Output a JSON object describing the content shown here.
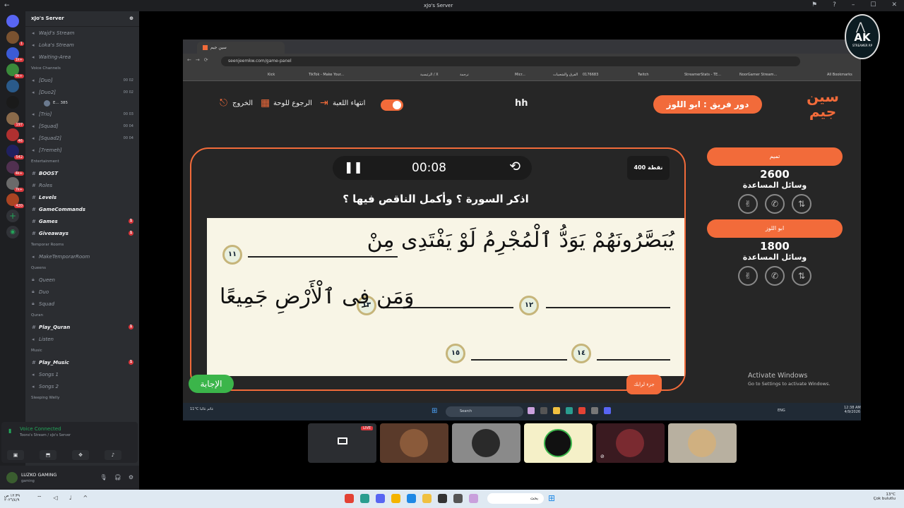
{
  "discord": {
    "window_title": "xJo's Server",
    "server_name": "xJo's Server",
    "rail_badges": [
      "1",
      "1k+",
      "9k+",
      "197",
      "46",
      "542",
      "4k+",
      "7k+",
      "420"
    ],
    "channels_top": [
      {
        "label": "Wajd's Stream",
        "type": "voice"
      },
      {
        "label": "Loka's Stream",
        "type": "voice"
      },
      {
        "label": "Waiting-Area",
        "type": "voice"
      }
    ],
    "voice_category": "Voice Channels",
    "voice_channels": [
      {
        "label": "[Duo]",
        "count": "00 02"
      },
      {
        "label": "[Duo2]",
        "count": "00 02"
      },
      {
        "label": "[Trio]",
        "count": "00 03"
      },
      {
        "label": "[Squad]",
        "count": "00 04"
      },
      {
        "label": "[Squad2]",
        "count": "00 04"
      },
      {
        "label": "[7remeh]",
        "count": ""
      }
    ],
    "sub_user": "E...",
    "sub_user_extra": "385",
    "entertainment_category": "Entertainment",
    "entertainment": [
      {
        "label": "BOOST",
        "unread": ""
      },
      {
        "label": "Roles",
        "unread": ""
      },
      {
        "label": "Levels",
        "unread": ""
      },
      {
        "label": "GameCommands",
        "unread": ""
      },
      {
        "label": "Games",
        "unread": "1"
      },
      {
        "label": "Giveaways",
        "unread": "1"
      }
    ],
    "temp_category": "Temporar Rooms",
    "temp_room": "MakeTemporarRoom",
    "queens_category": "Queens",
    "queens": [
      "Queen",
      "Duo",
      "Squad"
    ],
    "quran_category": "Quran",
    "quran": [
      {
        "label": "Play_Quran",
        "unread": "1"
      },
      {
        "label": "Listen",
        "unread": ""
      }
    ],
    "music_category": "Music",
    "music": [
      {
        "label": "Play_Music",
        "unread": "1"
      },
      {
        "label": "Songs 1",
        "unread": ""
      },
      {
        "label": "Songs 2",
        "unread": ""
      }
    ],
    "sleeping_category": "Sleeping Welly",
    "voice_status": "Voice Connected",
    "voice_sub": "Toons's Stream / xJo's Server",
    "username": "LUZKO GAMING",
    "user_status": "gaming"
  },
  "browser": {
    "tab_title": "سين جيم",
    "url": "seenjeemkw.com/game-panel",
    "bookmarks": [
      "Kick",
      "TikTok - Make Your...",
      "الرئيسية / X",
      "ترجمة",
      "Micr...",
      "الفرق والشعبيات",
      "0176683",
      "Twitch",
      "StreamerStats - TE...",
      "NoorGamer Stream...",
      "All Bookmarks"
    ]
  },
  "game": {
    "logo_text": "سين جيم",
    "turn_label": "دور فريق : ابو اللوز",
    "center_text": "hh",
    "end_game": "انتهاء اللعبة",
    "back_board": "الرجوع للوحة",
    "exit": "الخروج",
    "timer": "00:08",
    "points": "400 نقطة",
    "question": "اذكر السورة ؟ وأكمل الناقص فيها ؟",
    "verse_line1": "يُبَصَّرُونَهُمْ يَوَدُّ ٱلْمُجْرِمُ لَوْ يَفْتَدِى مِنْ",
    "verse_line2": "وَمَن فِى ٱلْأَرْضِ جَمِيعًا",
    "markers": [
      "١١",
      "١٢",
      "١٣",
      "١٤",
      "١٥"
    ],
    "answer_button": "الإجابة",
    "joker_button": "جزء لرابك",
    "teams": [
      {
        "name": "تميم",
        "score": "2600",
        "helps": "وسائل المساعدة"
      },
      {
        "name": "ابو اللوز",
        "score": "1800",
        "helps": "وسائل المساعدة"
      }
    ],
    "activate_title": "Activate Windows",
    "activate_sub": "Go to Settings to activate Windows."
  },
  "remote_taskbar": {
    "weather_temp": "11°C",
    "weather_desc": "غائم غالبا",
    "search": "Search",
    "lang": "ENG",
    "time": "12:38 AM",
    "date": "4/9/2026"
  },
  "overlay": {
    "ak_title": "AK",
    "ak_sub": "STREAMER RP",
    "live_badge": "LIVE",
    "tile_colors": [
      "#2b2d31",
      "#5a3a2a",
      "#7a7a7a",
      "#f5f0c8",
      "#3a1a20",
      "#b8b0a0"
    ]
  },
  "host_taskbar": {
    "time": "١٢:٣٩ ص",
    "date": "٢٠٢٦/٤/٩",
    "search": "بحث",
    "temp": "13°C",
    "desc": "Çok bulutlu"
  },
  "colors": {
    "accent": "#f26b3a",
    "answer_green": "#3bb54a",
    "discord_bg": "#2b2d31"
  }
}
